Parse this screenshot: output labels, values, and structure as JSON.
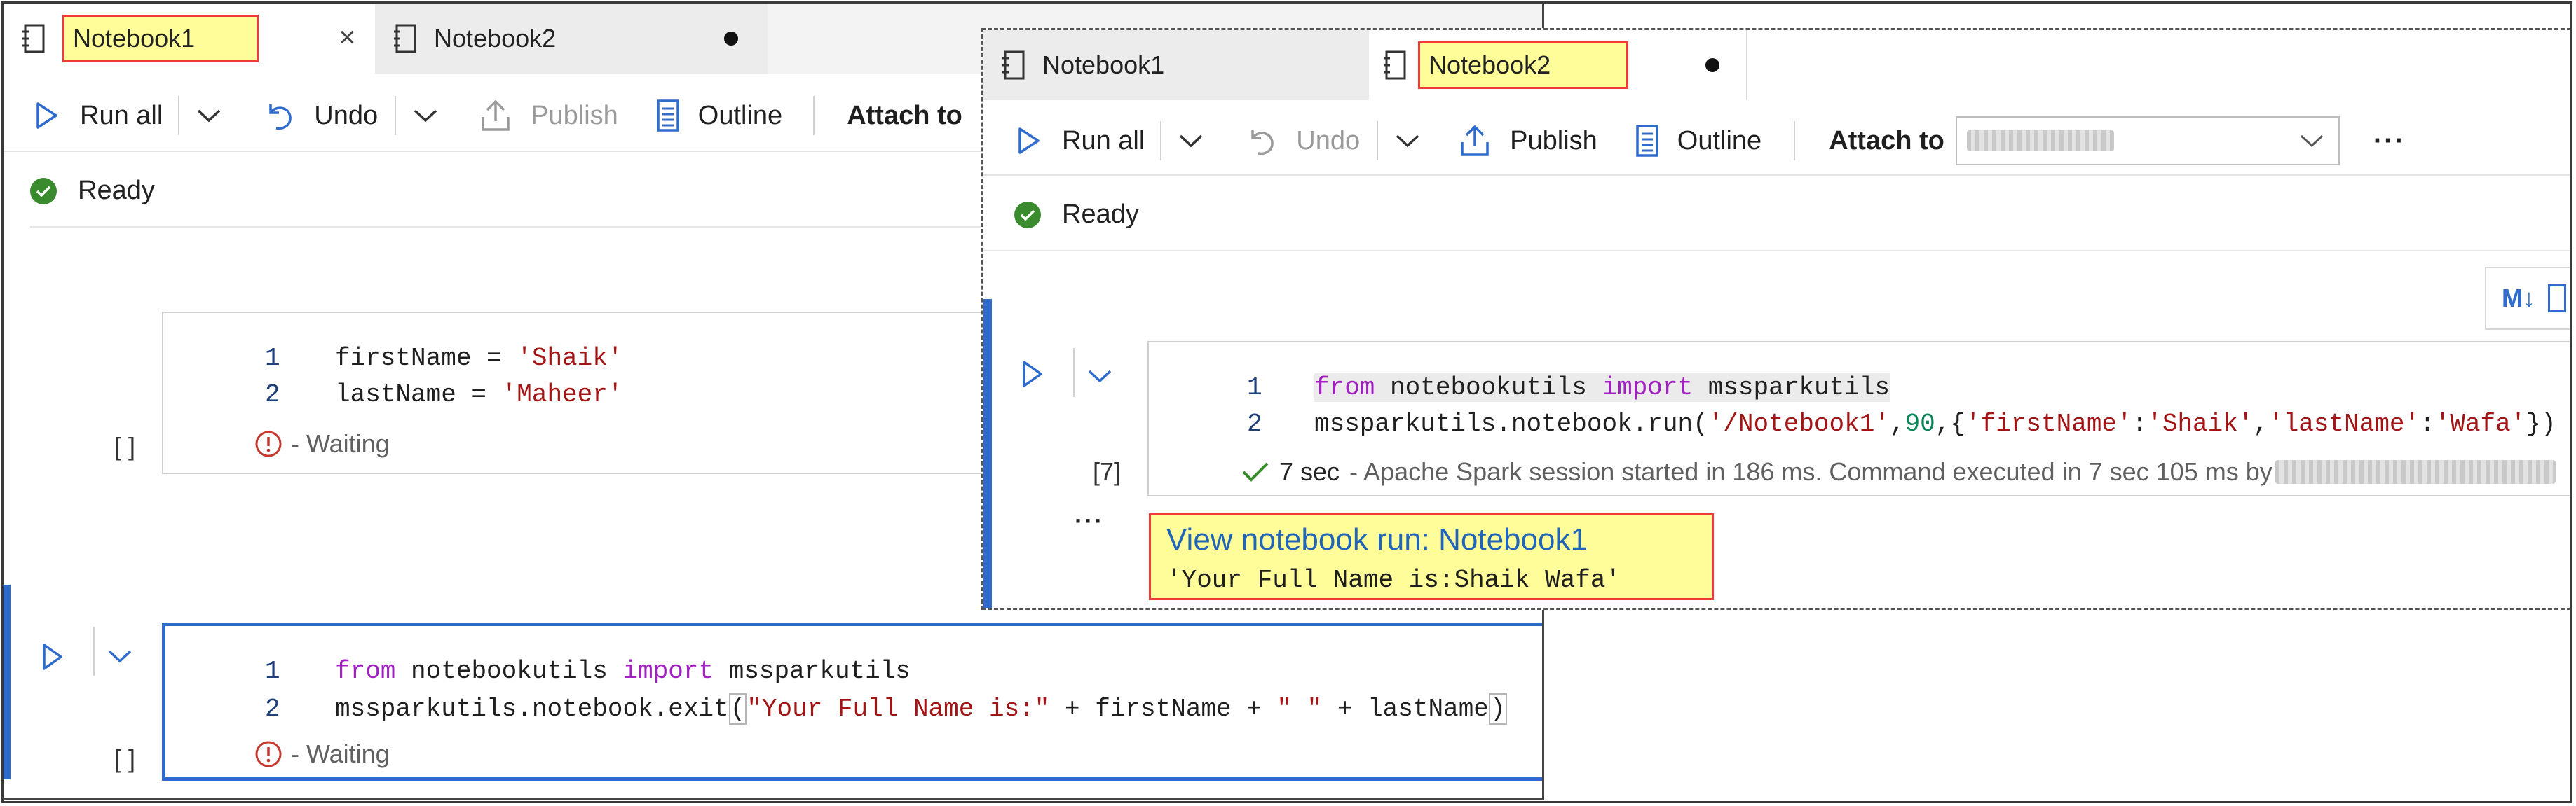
{
  "left_window": {
    "tabs": [
      {
        "label": "Notebook1",
        "active": true,
        "close": "×"
      },
      {
        "label": "Notebook2",
        "active": false
      }
    ],
    "toolbar": {
      "run_all": "Run all",
      "undo": "Undo",
      "publish": "Publish",
      "outline": "Outline",
      "attach_to": "Attach to"
    },
    "status": "Ready",
    "cells": [
      {
        "lines": [
          {
            "no": "1",
            "text": "firstName = ",
            "value": "'Shaik'"
          },
          {
            "no": "2",
            "text": "lastName = ",
            "value": "'Maheer'"
          }
        ],
        "exec": "[ ]",
        "state": "- Waiting"
      },
      {
        "line1": {
          "no": "1",
          "kw1": "from",
          "mod": " notebookutils ",
          "kw2": "import",
          "name": " mssparkutils"
        },
        "line2": {
          "no": "2",
          "pre": "mssparkutils.notebook.exit",
          "paren": "(",
          "str1": "\"Your Full Name is:\"",
          "mid": " + firstName + ",
          "str2": "\" \"",
          "post": " + lastName",
          "close": ")"
        },
        "exec": "[ ]",
        "state": "- Waiting"
      }
    ]
  },
  "right_window": {
    "tabs": [
      {
        "label": "Notebook1",
        "active": false
      },
      {
        "label": "Notebook2",
        "active": true
      }
    ],
    "toolbar": {
      "run_all": "Run all",
      "undo": "Undo",
      "publish": "Publish",
      "outline": "Outline",
      "attach_to": "Attach to",
      "more": "···"
    },
    "status": "Ready",
    "md_button": "M↓",
    "cell": {
      "line1": {
        "no": "1",
        "kw1": "from",
        "mod": " notebookutils ",
        "kw2": "import",
        "name": " mssparkutils"
      },
      "line2": {
        "no": "2",
        "pre": "mssparkutils.notebook.run(",
        "s1": "'/Notebook1'",
        "c1": ",",
        "n1": "90",
        "c2": ",{",
        "s2": "'firstName'",
        "c3": ":",
        "s3": "'Shaik'",
        "c4": ",",
        "s4": "'lastName'",
        "c5": ":",
        "s5": "'Wafa'",
        "end": "})"
      },
      "exec": "[7]",
      "duration": "7 sec",
      "message": "- Apache Spark session started in 186 ms. Command executed in 7 sec 105 ms by",
      "more": "···",
      "output_link": "View notebook run: Notebook1",
      "output_text": "'Your Full Name is:Shaik Wafa'"
    }
  },
  "colors": {
    "accent": "#2f6bcc",
    "success": "#3a8a2e",
    "highlight_fill": "#fffc9a",
    "highlight_border": "#f03a3a"
  }
}
